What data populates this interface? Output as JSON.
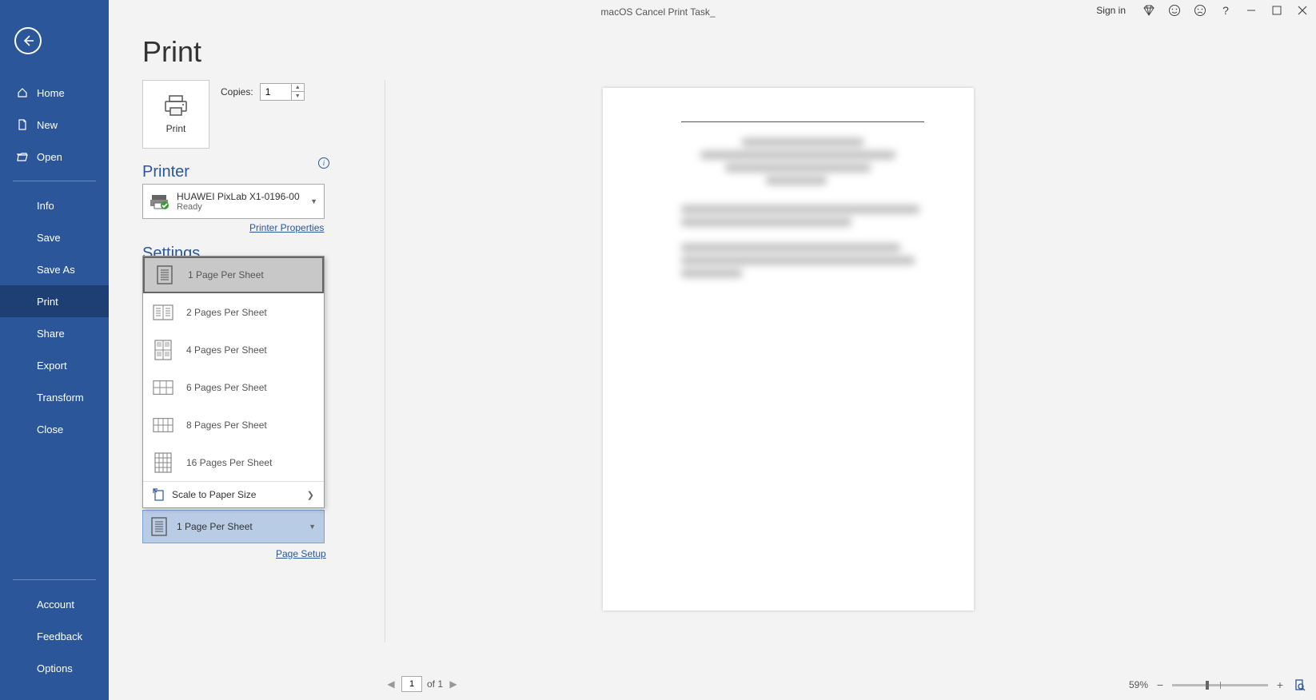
{
  "titlebar": {
    "document_title": "macOS Cancel Print Task_",
    "signin": "Sign in"
  },
  "sidebar": {
    "home": "Home",
    "new": "New",
    "open": "Open",
    "info": "Info",
    "save": "Save",
    "save_as": "Save As",
    "print": "Print",
    "share": "Share",
    "export": "Export",
    "transform": "Transform",
    "close": "Close",
    "account": "Account",
    "feedback": "Feedback",
    "options": "Options"
  },
  "page": {
    "title": "Print",
    "print_button": "Print",
    "copies_label": "Copies:",
    "copies_value": "1",
    "printer_heading": "Printer",
    "printer_name": "HUAWEI PixLab X1-0196-00",
    "printer_status": "Ready",
    "printer_properties": "Printer Properties",
    "settings_heading": "Settings",
    "page_setup": "Page Setup"
  },
  "pages_dropdown": {
    "options": [
      "1 Page Per Sheet",
      "2 Pages Per Sheet",
      "4 Pages Per Sheet",
      "6 Pages Per Sheet",
      "8 Pages Per Sheet",
      "16 Pages Per Sheet"
    ],
    "scale_label": "Scale to Paper Size",
    "selected": "1 Page Per Sheet"
  },
  "status": {
    "current_page": "1",
    "page_total_label": "of 1",
    "zoom": "59%"
  }
}
